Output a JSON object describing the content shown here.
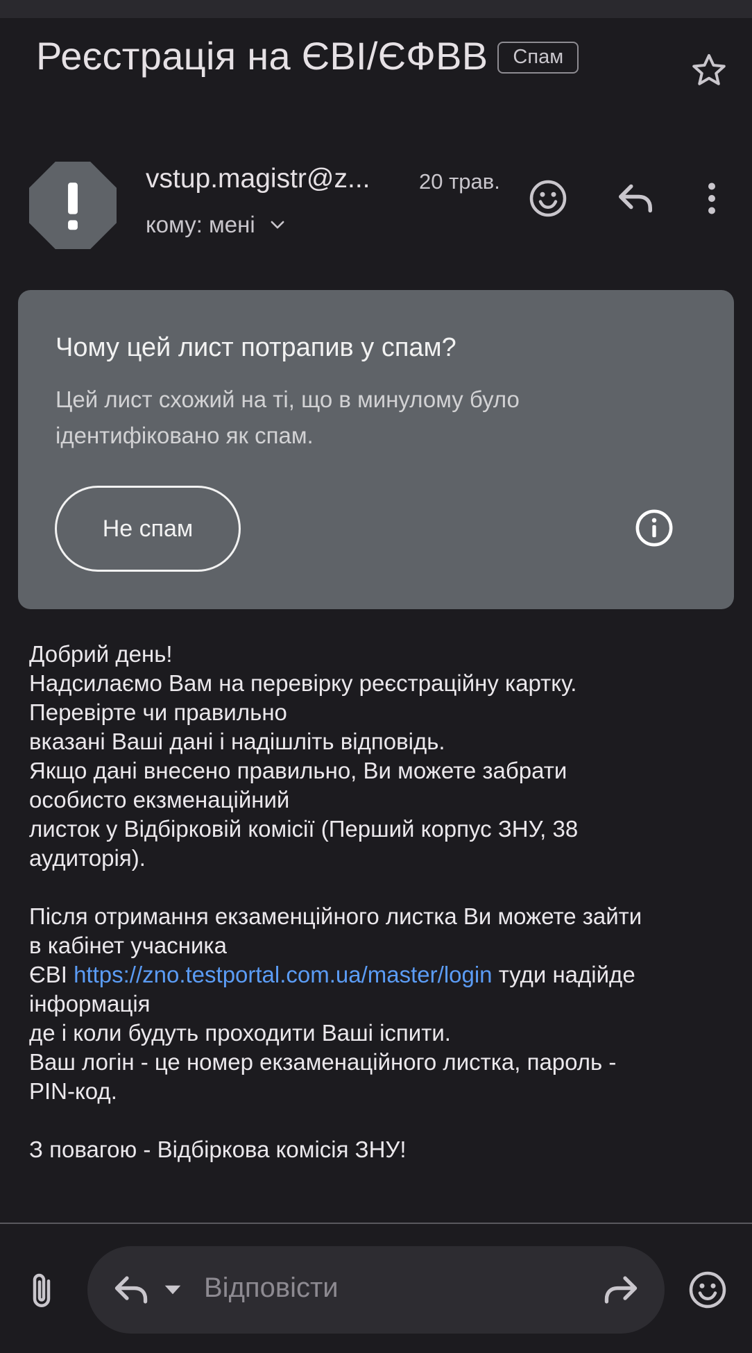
{
  "email": {
    "subject": "Реєстрація на ЄВІ/ЄФВВ",
    "label": "Спам",
    "sender": "vstup.magistr@z...",
    "date": "20 трав.",
    "recipient": "кому: мені"
  },
  "spam_card": {
    "title": "Чому цей лист потрапив у спам?",
    "line1": "Цей лист схожий на ті, що в минулому було",
    "line2": "ідентифіковано як спам.",
    "button": "Не спам"
  },
  "body": {
    "l1": "Добрий день!",
    "l2": "Надсилаємо Вам на перевірку реєстраційну картку.",
    "l3": "Перевірте чи правильно",
    "l4": "вказані Ваші дані і надішліть відповідь.",
    "l5": "Якщо дані внесено правильно, Ви можете забрати",
    "l6": "особисто екзменаційний",
    "l7": "листок у Відбірковій комісії (Перший корпус ЗНУ, 38",
    "l8": "аудиторія).",
    "l9": "Після отримання екзаменційного листка Ви можете зайти",
    "l10": "в кабінет учасника",
    "l11_prefix": "ЄВІ ",
    "l11_link": "https://zno.testportal.com.ua/master/login",
    "l11_suffix": " туди надійде",
    "l12": "інформація",
    "l13": "де і коли будуть проходити Ваші іспити.",
    "l14": "Ваш логін - це номер екзаменаційного листка, пароль -",
    "l15": "PIN-код.",
    "l16": "З повагою - Відбіркова комісія ЗНУ!"
  },
  "reply_bar": {
    "placeholder": "Відповісти"
  },
  "icons": {
    "star": "star-outline-icon",
    "avatar": "spam-warning-octagon-icon",
    "emoji": "emoji-react-icon",
    "reply": "reply-icon",
    "more": "more-vert-icon",
    "info": "info-icon",
    "attach": "attachment-icon",
    "forward": "forward-icon"
  },
  "colors": {
    "background": "#1c1b1f",
    "card": "#5f6368",
    "link": "#5b9cf5"
  }
}
